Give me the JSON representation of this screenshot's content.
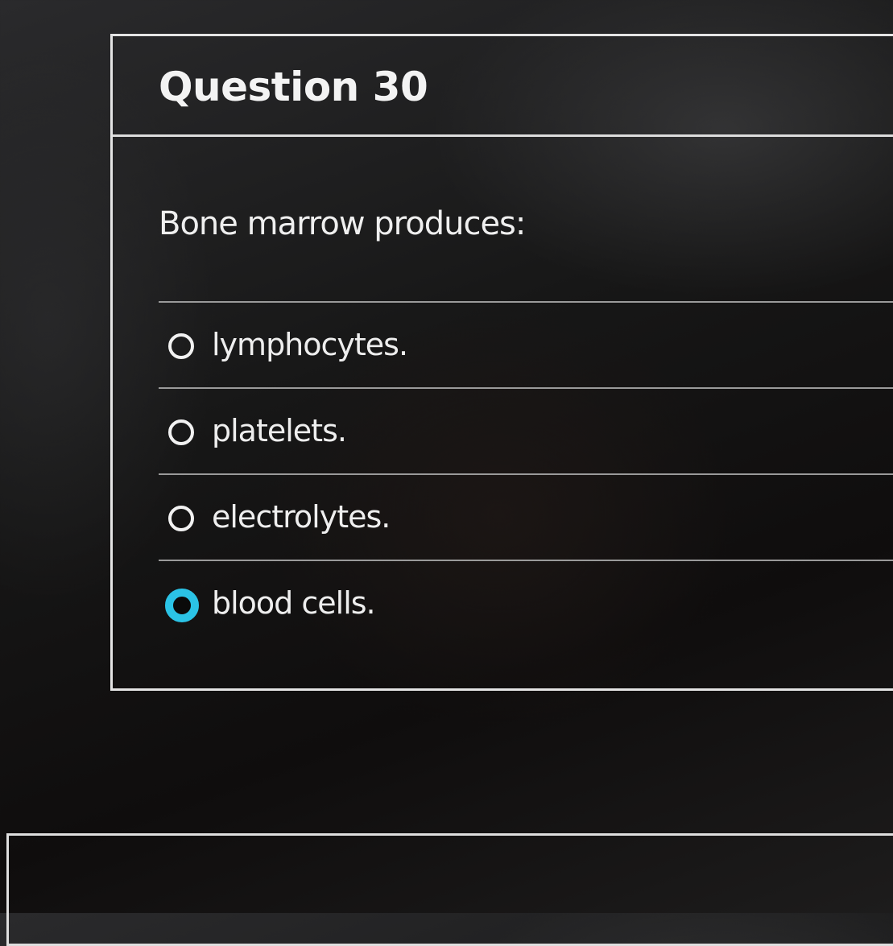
{
  "question": {
    "title": "Question 30",
    "prompt": "Bone marrow produces:",
    "options": [
      {
        "label": "lymphocytes.",
        "selected": false
      },
      {
        "label": "platelets.",
        "selected": false
      },
      {
        "label": "electrolytes.",
        "selected": false
      },
      {
        "label": "blood cells.",
        "selected": true
      }
    ]
  },
  "colors": {
    "selected_radio": "#2bc3e6",
    "background": "#151414",
    "card_border": "#e4e4e4"
  }
}
